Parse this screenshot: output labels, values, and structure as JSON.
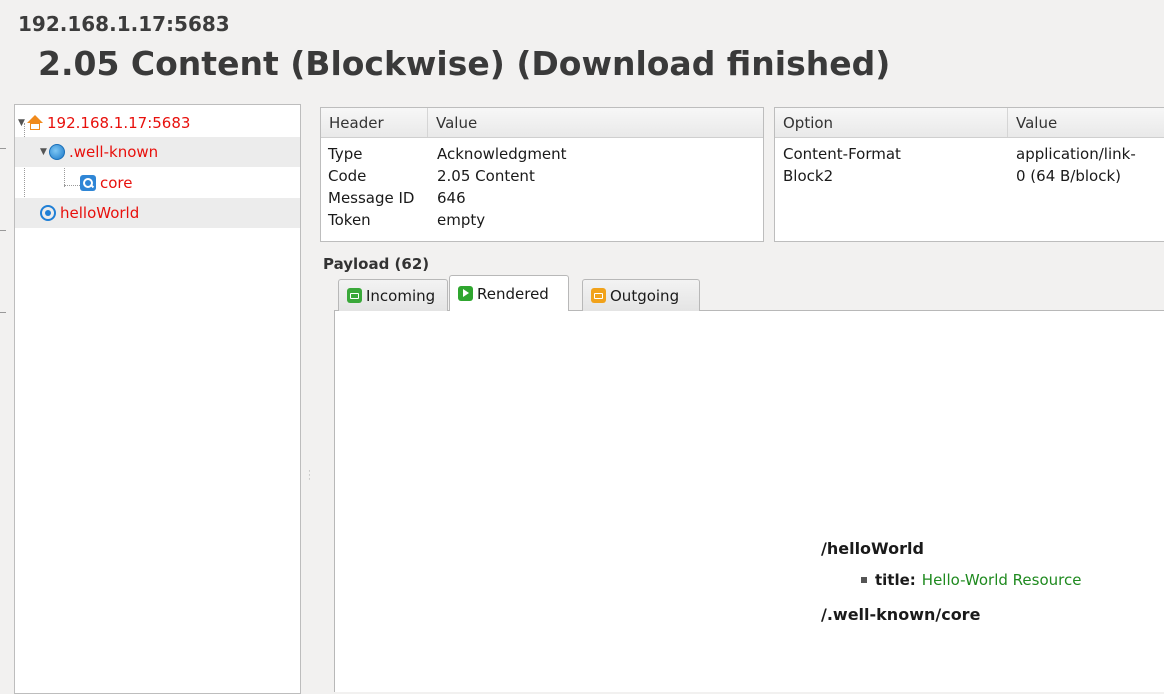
{
  "header": {
    "address": "192.168.1.17:5683",
    "status": "2.05 Content (Blockwise) (Download finished)"
  },
  "tree": {
    "root": {
      "label": "192.168.1.17:5683",
      "icon": "home-icon"
    },
    "well_known": {
      "label": ".well-known",
      "icon": "globe-icon"
    },
    "core": {
      "label": "core",
      "icon": "search-icon"
    },
    "hello": {
      "label": "helloWorld",
      "icon": "target-icon"
    }
  },
  "header_table": {
    "columns": [
      "Header",
      "Value"
    ],
    "rows": [
      [
        "Type",
        "Acknowledgment"
      ],
      [
        "Code",
        "2.05 Content"
      ],
      [
        "Message ID",
        "646"
      ],
      [
        "Token",
        "empty"
      ]
    ]
  },
  "option_table": {
    "columns": [
      "Option",
      "Value"
    ],
    "rows": [
      [
        "Content-Format",
        "application/link-"
      ],
      [
        "Block2",
        "0 (64 B/block)"
      ]
    ]
  },
  "payload": {
    "label": "Payload (62)",
    "tabs": [
      "Incoming",
      "Rendered",
      "Outgoing"
    ],
    "active_tab": "Rendered",
    "rendered": {
      "resources": [
        {
          "path": "/helloWorld",
          "attr_key": "title:",
          "attr_value": "Hello-World Resource"
        },
        {
          "path": "/.well-known/core"
        }
      ]
    }
  },
  "colors": {
    "tree_text": "#e8100c",
    "attr_value": "#1f8a1f",
    "selection": "#ececec"
  }
}
